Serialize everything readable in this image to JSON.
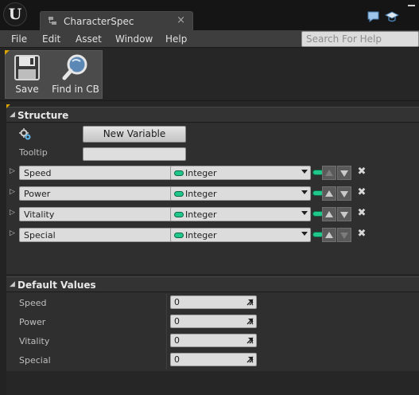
{
  "window": {
    "tab_title": "CharacterSpec",
    "tab_close": "×"
  },
  "menu": {
    "items": [
      "File",
      "Edit",
      "Asset",
      "Window",
      "Help"
    ],
    "search_placeholder": "Search For Help"
  },
  "toolbar": {
    "save_label": "Save",
    "find_label": "Find in CB"
  },
  "structure": {
    "title": "Structure",
    "new_variable_label": "New Variable",
    "tooltip_label": "Tooltip",
    "tooltip_value": "",
    "variables": [
      {
        "name": "Speed",
        "type": "Integer",
        "up_enabled": false,
        "down_enabled": true
      },
      {
        "name": "Power",
        "type": "Integer",
        "up_enabled": true,
        "down_enabled": true
      },
      {
        "name": "Vitality",
        "type": "Integer",
        "up_enabled": true,
        "down_enabled": true
      },
      {
        "name": "Special",
        "type": "Integer",
        "up_enabled": true,
        "down_enabled": false
      }
    ],
    "delete_glyph": "✖"
  },
  "default_values": {
    "title": "Default Values",
    "fields": [
      {
        "label": "Speed",
        "value": "0"
      },
      {
        "label": "Power",
        "value": "0"
      },
      {
        "label": "Vitality",
        "value": "0"
      },
      {
        "label": "Special",
        "value": "0"
      }
    ]
  },
  "colors": {
    "pin_integer": "#21c78a",
    "accent_gold": "#d8a200"
  }
}
